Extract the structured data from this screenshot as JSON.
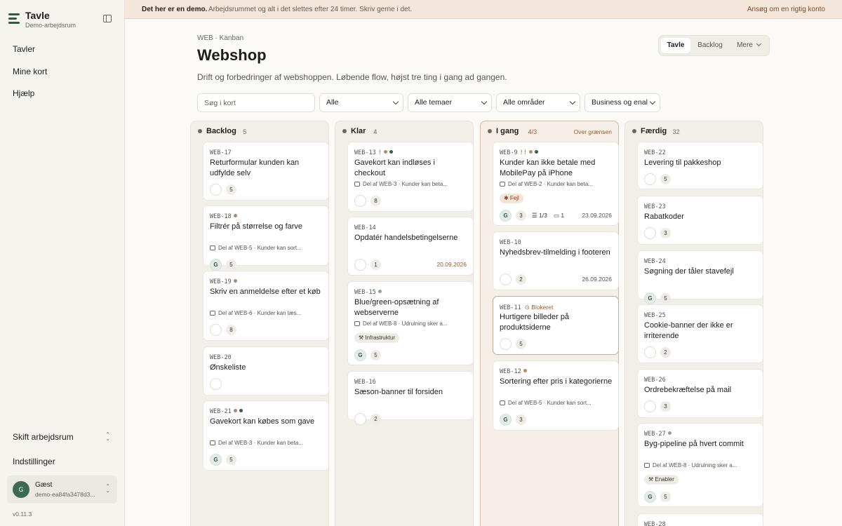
{
  "sidebar": {
    "app_title": "Tavle",
    "app_subtitle": "Demo-arbejdsrum",
    "nav": [
      "Tavler",
      "Mine kort",
      "Hjælp"
    ],
    "switch_workspace": "Skift arbejdsrum",
    "settings": "Indstillinger",
    "user": {
      "initial": "G",
      "name": "Gæst",
      "id": "demo-ea84fa3478d3..."
    },
    "version": "v0.11.3"
  },
  "banner": {
    "strong": "Det her er en demo.",
    "text": "Arbejdsrummet og alt i det slettes efter 24 timer. Skriv gerne i det.",
    "link": "Ansøg om en rigtig konto"
  },
  "header": {
    "breadcrumb": "WEB · Kanban",
    "title": "Webshop",
    "description": "Drift og forbedringer af webshoppen. Løbende flow, højst tre ting i gang ad gangen.",
    "views": [
      "Tavle",
      "Backlog",
      "Mere"
    ]
  },
  "filters": {
    "search_placeholder": "Søg i kort",
    "selects": [
      "Alle",
      "Alle temaer",
      "Alle områder",
      "Business og enal"
    ]
  },
  "colors": {
    "accent": "#2e5a46",
    "warn": "#9a5a2e",
    "dot_brown": "#b08a6a",
    "dot_green": "#3e5a4a",
    "dot_sage": "#8da596"
  },
  "columns": [
    {
      "title": "Backlog",
      "count": "5",
      "warning": "",
      "cards": [
        {
          "id": "WEB-17",
          "title": "Returformular kunden kan udfylde selv",
          "points": "5"
        },
        {
          "id": "WEB-18",
          "dots": [
            "#b08a6a"
          ],
          "title": "Filtrér på størrelse og farve",
          "parent": "Del af WEB-5 · Kunder kan sort...",
          "assignee": "G",
          "points": "5"
        },
        {
          "id": "WEB-19",
          "dots": [
            "#b08a6a"
          ],
          "title": "Skriv en anmeldelse efter et køb",
          "parent": "Del af WEB-6 · Kunder kan læs...",
          "points": "8"
        },
        {
          "id": "WEB-20",
          "title": "Ønskeliste"
        },
        {
          "id": "WEB-21",
          "dots": [
            "#b08a6a",
            "#3e5a4a"
          ],
          "title": "Gavekort kan købes som gave",
          "parent": "Del af WEB-3 · Kunder kan beta...",
          "assignee": "G",
          "points": "5"
        }
      ]
    },
    {
      "title": "Klar",
      "count": "4",
      "warning": "",
      "cards": [
        {
          "id": "WEB-13",
          "bang": "!",
          "dots": [
            "#b08a6a",
            "#3e5a4a"
          ],
          "title": "Gavekort kan indløses i checkout",
          "parent": "Del af WEB-3 · Kunder kan beta...",
          "points": "8"
        },
        {
          "id": "WEB-14",
          "title": "Opdatér handelsbetingelserne",
          "points": "1",
          "date": "20.09.2026"
        },
        {
          "id": "WEB-15",
          "dots": [
            "#8da596"
          ],
          "title": "Blue/green-opsætning af webserverne",
          "parent": "Del af WEB-8 · Udrulning sker a...",
          "tag": "Infrastruktur",
          "assignee": "G",
          "points": "5"
        },
        {
          "id": "WEB-16",
          "title": "Sæson-banner til forsiden",
          "points": "2"
        }
      ]
    },
    {
      "title": "I gang",
      "count": "4/3",
      "warning": "Over grænsen",
      "cards": [
        {
          "id": "WEB-9",
          "bang": "!!",
          "dots": [
            "#b08a6a",
            "#3e5a4a"
          ],
          "title": "Kunder kan ikke betale med MobilePay på iPhone",
          "parent": "Del af WEB-2 · Kunder kan beta...",
          "tag": "Fejl",
          "assignee": "G",
          "points": "3",
          "checklist": "1/3",
          "comments": "1",
          "date": "23.09.2026"
        },
        {
          "id": "WEB-10",
          "title": "Nyhedsbrev-tilmelding i footeren",
          "points": "2",
          "date": "26.09.2026"
        },
        {
          "id": "WEB-11",
          "blocked": "Blokeret",
          "title": "Hurtigere billeder på produktsiderne",
          "points": "5"
        },
        {
          "id": "WEB-12",
          "dots": [
            "#b08a6a"
          ],
          "title": "Sortering efter pris i kategorierne",
          "parent": "Del af WEB-5 · Kunder kan sort...",
          "assignee": "G",
          "points": "3"
        }
      ]
    },
    {
      "title": "Færdig",
      "count": "32",
      "warning": "",
      "cards": [
        {
          "id": "WEB-22",
          "title": "Levering til pakkeshop",
          "points": "5"
        },
        {
          "id": "WEB-23",
          "title": "Rabatkoder",
          "points": "3"
        },
        {
          "id": "WEB-24",
          "title": "Søgning der tåler stavefejl",
          "assignee": "G",
          "points": "5"
        },
        {
          "id": "WEB-25",
          "title": "Cookie-banner der ikke er irriterende",
          "points": "2"
        },
        {
          "id": "WEB-26",
          "title": "Ordrebekræftelse på mail",
          "points": "3"
        },
        {
          "id": "WEB-27",
          "dots": [
            "#8da596"
          ],
          "title": "Byg-pipeline på hvert commit",
          "parent": "Del af WEB-8 · Udrulning sker a...",
          "tag": "Enabler",
          "assignee": "G",
          "points": "5"
        },
        {
          "id": "WEB-28"
        }
      ]
    }
  ]
}
